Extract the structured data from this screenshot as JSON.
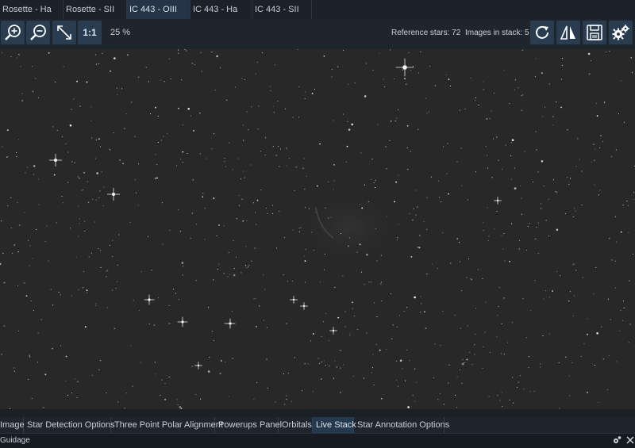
{
  "document_tabs": [
    {
      "label": "Rosette - Ha",
      "active": false
    },
    {
      "label": "Rosette - SII",
      "active": false
    },
    {
      "label": "IC 443 - OIII",
      "active": true
    },
    {
      "label": "IC 443 - Ha",
      "active": false
    },
    {
      "label": "IC 443 - SII",
      "active": false
    }
  ],
  "toolbar": {
    "one_to_one_label": "1:1",
    "zoom_level": "25 %",
    "reference_stars": "Reference stars: 72",
    "images_in_stack": "Images in stack: 5",
    "icons": [
      "zoom-in-icon",
      "zoom-out-icon",
      "fit-to-screen-icon",
      "refresh-icon",
      "flip-icon",
      "save-icon",
      "settings-icon"
    ]
  },
  "bottom_tabs": [
    {
      "label": "Image",
      "active": false
    },
    {
      "label": "Star Detection Options",
      "active": false
    },
    {
      "label": "Three Point Polar Alignment",
      "active": false
    },
    {
      "label": "Powerups Panel",
      "active": false
    },
    {
      "label": "Orbitals",
      "active": false
    },
    {
      "label": "Live Stack",
      "active": true
    },
    {
      "label": "Star Annotation Options",
      "active": false
    }
  ],
  "panel": {
    "title": "Guidage",
    "icons": [
      "settings-small-icon",
      "close-icon"
    ]
  },
  "colors": {
    "accent": "#2a3c50",
    "active_tab": "#253547",
    "background": "#1d232b",
    "image_bg": "#282828"
  }
}
